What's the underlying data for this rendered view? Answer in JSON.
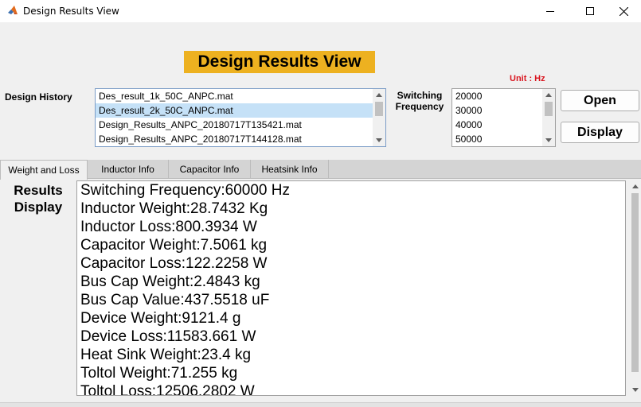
{
  "window": {
    "title": "Design Results View",
    "icon": "matlab-icon"
  },
  "heading": "Design Results View",
  "unit_label": "Unit : Hz",
  "design_history": {
    "label": "Design History",
    "items": [
      "Des_result_1k_50C_ANPC.mat",
      "Des_result_2k_50C_ANPC.mat",
      "Design_Results_ANPC_20180717T135421.mat",
      "Design_Results_ANPC_20180717T144128.mat"
    ],
    "selected_index": 1
  },
  "switching_frequency": {
    "label_line1": "Switching",
    "label_line2": "Frequency",
    "items": [
      "20000",
      "30000",
      "40000",
      "50000"
    ]
  },
  "buttons": {
    "open": "Open",
    "display": "Display"
  },
  "tabs": [
    {
      "label": "Weight and Loss",
      "active": true
    },
    {
      "label": "Inductor Info",
      "active": false
    },
    {
      "label": "Capacitor Info",
      "active": false
    },
    {
      "label": "Heatsink Info",
      "active": false
    }
  ],
  "results": {
    "label_line1": "Results",
    "label_line2": "Display",
    "lines": [
      "Switching Frequency:60000 Hz",
      "Inductor Weight:28.7432 Kg",
      "Inductor Loss:800.3934 W",
      "Capacitor Weight:7.5061 kg",
      "Capacitor Loss:122.2258 W",
      "Bus Cap Weight:2.4843 kg",
      "Bus Cap Value:437.5518 uF",
      "Device Weight:9121.4 g",
      "Device Loss:11583.661 W",
      "Heat Sink Weight:23.4 kg",
      "Toltol Weight:71.255 kg",
      "Toltol Loss:12506.2802 W"
    ]
  },
  "colors": {
    "heading_bg": "#edb120",
    "unit_color": "#d9141e",
    "selection": "#c5e1f7"
  }
}
